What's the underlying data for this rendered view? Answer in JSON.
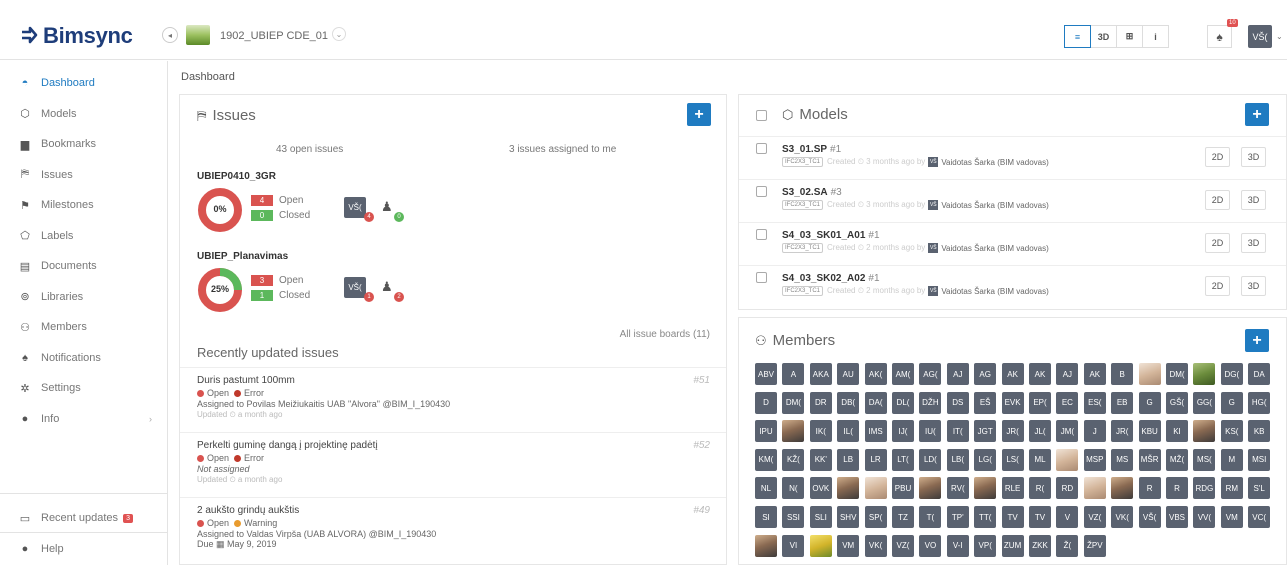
{
  "brand": {
    "name": "Bimsync"
  },
  "project": {
    "name": "1902_UBIEP CDE_01"
  },
  "view_buttons": [
    {
      "label": "≡",
      "icon": "list-icon",
      "active": true
    },
    {
      "label": "3D",
      "icon": "3d-icon",
      "active": false
    },
    {
      "label": "⊞",
      "icon": "split-icon",
      "active": false
    },
    {
      "label": "i",
      "icon": "info-icon",
      "active": false
    }
  ],
  "notifications": {
    "badge": "10"
  },
  "user": {
    "initials": "VŠ("
  },
  "sidebar": {
    "items": [
      {
        "label": "Dashboard",
        "icon": "dashboard-icon",
        "glyph": "◓",
        "active": true
      },
      {
        "label": "Models",
        "icon": "cube-icon",
        "glyph": "⬡",
        "active": false
      },
      {
        "label": "Bookmarks",
        "icon": "bookmark-icon",
        "glyph": "▆",
        "active": false
      },
      {
        "label": "Issues",
        "icon": "issues-icon",
        "glyph": "⛿",
        "active": false
      },
      {
        "label": "Milestones",
        "icon": "milestone-icon",
        "glyph": "⚑",
        "active": false
      },
      {
        "label": "Labels",
        "icon": "tag-icon",
        "glyph": "⬠",
        "active": false
      },
      {
        "label": "Documents",
        "icon": "document-icon",
        "glyph": "▤",
        "active": false
      },
      {
        "label": "Libraries",
        "icon": "library-icon",
        "glyph": "⊚",
        "active": false
      },
      {
        "label": "Members",
        "icon": "members-icon",
        "glyph": "⚇",
        "active": false
      },
      {
        "label": "Notifications",
        "icon": "bell-icon",
        "glyph": "♠",
        "active": false
      },
      {
        "label": "Settings",
        "icon": "gear-icon",
        "glyph": "✲",
        "active": false
      },
      {
        "label": "Info",
        "icon": "info-circle-icon",
        "glyph": "●",
        "active": false,
        "chevron": "›"
      }
    ],
    "recent_updates": {
      "label": "Recent updates",
      "badge": "3"
    },
    "help": {
      "label": "Help"
    }
  },
  "breadcrumb": "Dashboard",
  "issues": {
    "title": "Issues",
    "open_issues": "43 open issues",
    "assigned_to_me": "3 issues assigned to me",
    "boards": [
      {
        "name": "UBIEP0410_3GR",
        "percent_label": "0%",
        "percent": 0,
        "open_count": "4",
        "open_label": "Open",
        "closed_count": "0",
        "closed_label": "Closed",
        "assignee_initials": "VŠ(",
        "assignee_count": "4",
        "unassigned_count": "0"
      },
      {
        "name": "UBIEP_Planavimas",
        "percent_label": "25%",
        "percent": 25,
        "open_count": "3",
        "open_label": "Open",
        "closed_count": "1",
        "closed_label": "Closed",
        "assignee_initials": "VŠ(",
        "assignee_count": "1",
        "unassigned_count": "2"
      }
    ],
    "all_boards": "All issue boards (11)",
    "recent_title": "Recently updated issues",
    "recent": [
      {
        "title": "Duris pastumt 100mm",
        "num": "#51",
        "status": "Open",
        "type": "Error",
        "type_color": "#c0392b",
        "assigned": "Assigned to Povilas Meižiukaitis UAB \"Alvora\" @BIM_I_190430",
        "due": "",
        "updated": "Updated ⏲ a month ago"
      },
      {
        "title": "Perkelti guminę dangą į projektinę padėtį",
        "num": "#52",
        "status": "Open",
        "type": "Error",
        "type_color": "#c0392b",
        "assigned": "Not assigned",
        "due": "",
        "updated": "Updated ⏲ a month ago"
      },
      {
        "title": "2 aukšto grindų aukštis",
        "num": "#49",
        "status": "Open",
        "type": "Warning",
        "type_color": "#e89b2e",
        "assigned": "Assigned to Valdas Virpša (UAB ALVORA) @BIM_I_190430",
        "due": "Due ▦ May 9, 2019",
        "updated": ""
      }
    ]
  },
  "models": {
    "title": "Models",
    "rows": [
      {
        "name": "S3_01.SP",
        "rev": "#1",
        "tag": "IFC2X3_TC1",
        "created": "Created ⏲ 3 months ago by",
        "by_initials": "VŠ",
        "by": "Vaidotas Šarka (BIM vadovas)"
      },
      {
        "name": "S3_02.SA",
        "rev": "#3",
        "tag": "IFC2X3_TC1",
        "created": "Created ⏲ 3 months ago by",
        "by_initials": "VŠ",
        "by": "Vaidotas Šarka (BIM vadovas)"
      },
      {
        "name": "S4_03_SK01_A01",
        "rev": "#1",
        "tag": "IFC2X3_TC1",
        "created": "Created ⏲ 2 months ago by",
        "by_initials": "VŠ",
        "by": "Vaidotas Šarka (BIM vadovas)"
      },
      {
        "name": "S4_03_SK02_A02",
        "rev": "#1",
        "tag": "IFC2X3_TC1",
        "created": "Created ⏲ 2 months ago by",
        "by_initials": "VŠ",
        "by": "Vaidotas Šarka (BIM vadovas)"
      }
    ],
    "btn_2d": "2D",
    "btn_3d": "3D"
  },
  "members": {
    "title": "Members",
    "avatars": [
      "ABV",
      "A",
      "AKA",
      "AU",
      "AK(",
      "AM(",
      "AG(",
      "AJ",
      "AG",
      "AK",
      "AK",
      "AJ",
      "AK",
      "B",
      "@face-light",
      "DM(",
      "@face-green",
      "DG(",
      "DA",
      "D",
      "DM(",
      "DR",
      "DB(",
      "DA(",
      "DL(",
      "DŽH",
      "DS",
      "EŠ",
      "EVK",
      "EP(",
      "EC",
      "ES(",
      "EB",
      "G",
      "GŠ(",
      "GG(",
      "G",
      "HG(",
      "IPU",
      "@face",
      "IK(",
      "IL(",
      "IMS",
      "IJ(",
      "IU(",
      "IT(",
      "JGT",
      "JR(",
      "JL(",
      "JM(",
      "J",
      "JR(",
      "KBU",
      "KI",
      "@face",
      "KS(",
      "KB",
      "KM(",
      "KŽ(",
      "KK'",
      "LB",
      "LR",
      "LT(",
      "LD(",
      "LB(",
      "LG(",
      "LS(",
      "ML",
      "@face-light",
      "MSP",
      "MS",
      "MŠR",
      "MŽ(",
      "MS(",
      "M",
      "MSI",
      "NL",
      "N(",
      "OVK",
      "@face",
      "@face-light",
      "PBU",
      "@face",
      "RV(",
      "@face",
      "RLE",
      "R(",
      "RD",
      "@face-light",
      "@face",
      "R",
      "R",
      "RDG",
      "RM",
      "S'L",
      "SI",
      "SSI",
      "SLI",
      "SHV",
      "SP(",
      "TZ",
      "T(",
      "TP'",
      "TT(",
      "TV",
      "TV",
      "V",
      "VZ(",
      "VK(",
      "VŠ(",
      "VBS",
      "VV(",
      "VM",
      "VC(",
      "@face",
      "VI",
      "@face-yellow",
      "VM",
      "VK(",
      "VZ(",
      "VO",
      "V-I",
      "VP(",
      "ZUM",
      "ZKK",
      "Ž(",
      "ŽPV"
    ]
  },
  "colors": {
    "accent": "#1f7bc1",
    "error": "#c0392b",
    "open_red": "#d9534f",
    "closed_green": "#5cb85c",
    "warning": "#e89b2e",
    "avatar_gray": "#5a6270"
  }
}
